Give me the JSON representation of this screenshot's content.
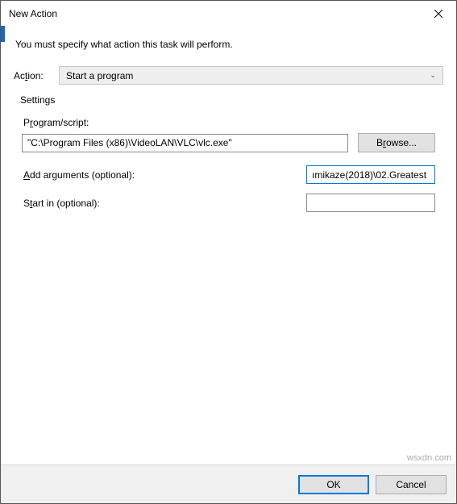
{
  "window": {
    "title": "New Action"
  },
  "intro": "You must specify what action this task will perform.",
  "action": {
    "label": "Action:",
    "selected": "Start a program"
  },
  "settings": {
    "legend": "Settings",
    "program": {
      "label_pre": "P",
      "label_u": "r",
      "label_post": "ogram/script:",
      "value": "\"C:\\Program Files (x86)\\VideoLAN\\VLC\\vlc.exe\""
    },
    "browse": "Browse...",
    "arguments": {
      "label_u": "A",
      "label_post": "dd arguments (optional):",
      "value": "ımikaze(2018)\\02.Greatest"
    },
    "startin": {
      "label_pre": "S",
      "label_u": "t",
      "label_post": "art in (optional):",
      "value": ""
    }
  },
  "footer": {
    "ok": "OK",
    "cancel": "Cancel"
  },
  "watermark": "wsxdn.com"
}
